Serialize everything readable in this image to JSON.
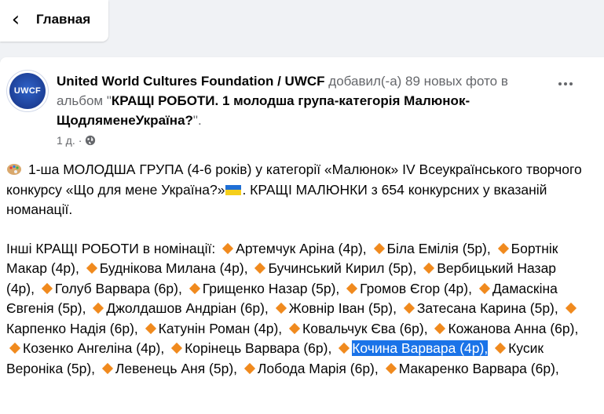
{
  "nav": {
    "back_label": "Главная"
  },
  "post": {
    "author": "United World Cultures Foundation / UWCF",
    "action_text": " добавил(-а) 89 новых фото в альбом \"",
    "album": "КРАЩІ РОБОТИ. 1 молодша група-категорія Малюнок-ЩодляменеУкраїна?",
    "action_end": "\".",
    "time": "1 д.",
    "avatar_label": "UWCF"
  },
  "body": {
    "intro_a": "1-ша МОЛОДША ГРУПА (4-6 років) у категорії «Малюнок» IV Всеукраїнського творчого конкурсу «Що для мене Україна?»",
    "intro_b": ". КРАЩІ МАЛЮНКИ  з 654 конкурсних у вказаній номанації.",
    "others_lead": "Інші КРАЩІ РОБОТИ в номінації:",
    "names": [
      "Артемчук Аріна (4р),",
      "Біла Емілія (5р),",
      "Бортнік Макар (4р),",
      "Буднікова Милана (4р),",
      "Бучинський Кирил (5р),",
      "Вербицький Назар (4р),",
      "Голуб Варвара (6р),",
      "Грищенко Назар (5р),",
      "Громов Єгор (4р),",
      "Дамаскіна Євгенія (5р),",
      "Джолдашов Андріан (6р),",
      "Жовнір Іван (5р),",
      "Затесана Карина (5р),",
      "Карпенко Надія (6р),",
      "Катунін Роман (4р),",
      "Ковальчук Єва (6р),",
      "Кожанова Анна (6р),",
      "Козенко Ангеліна (4р),",
      "Корінець Варвара (6р),",
      "Кочина Варвара (4р),",
      "Кусик Вероніка (5р),",
      "Левенець Аня (5р),",
      "Лобода Марія (6р),",
      "Макаренко Варвара (6р),"
    ],
    "highlighted_index": 19
  },
  "colors": {
    "accent_blue": "#1a73e8",
    "diamond_orange": "#f08a1e",
    "secondary_text": "#65676b"
  }
}
